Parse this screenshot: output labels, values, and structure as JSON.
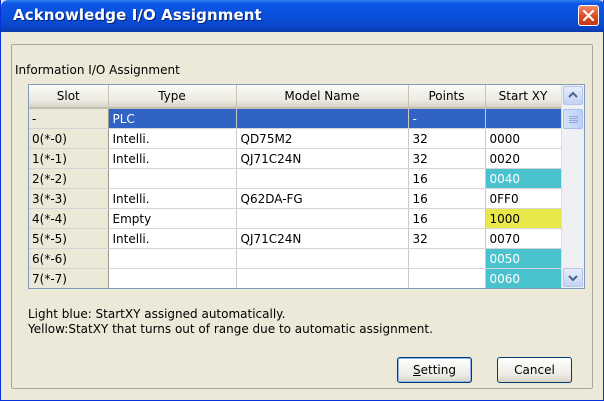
{
  "window": {
    "title": "Acknowledge I/O Assignment"
  },
  "group": {
    "label": "Information I/O Assignment"
  },
  "table": {
    "columns": [
      "Slot",
      "Type",
      "Model Name",
      "Points",
      "Start XY"
    ],
    "rows": [
      {
        "slot": "-",
        "type": "PLC",
        "model": "",
        "points": "-",
        "start": "",
        "highlight": "selected"
      },
      {
        "slot": "0(*-0)",
        "type": "Intelli.",
        "model": "QD75M2",
        "points": "32",
        "start": "0000",
        "highlight": ""
      },
      {
        "slot": "1(*-1)",
        "type": "Intelli.",
        "model": "QJ71C24N",
        "points": "32",
        "start": "0020",
        "highlight": ""
      },
      {
        "slot": "2(*-2)",
        "type": "",
        "model": "",
        "points": "16",
        "start": "0040",
        "highlight": "auto"
      },
      {
        "slot": "3(*-3)",
        "type": "Intelli.",
        "model": "Q62DA-FG",
        "points": "16",
        "start": "0FF0",
        "highlight": ""
      },
      {
        "slot": "4(*-4)",
        "type": "Empty",
        "model": "",
        "points": "16",
        "start": "1000",
        "highlight": "outrange"
      },
      {
        "slot": "5(*-5)",
        "type": "Intelli.",
        "model": "QJ71C24N",
        "points": "32",
        "start": "0070",
        "highlight": ""
      },
      {
        "slot": "6(*-6)",
        "type": "",
        "model": "",
        "points": "",
        "start": "0050",
        "highlight": "auto"
      },
      {
        "slot": "7(*-7)",
        "type": "",
        "model": "",
        "points": "",
        "start": "0060",
        "highlight": "auto"
      }
    ]
  },
  "notes": {
    "light_blue": "Light blue: StartXY assigned automatically.",
    "yellow": "Yellow:StatXY that turns out of range due to automatic assignment."
  },
  "buttons": {
    "setting": {
      "prefix": "",
      "mnemonic": "S",
      "rest": "etting"
    },
    "cancel": "Cancel"
  },
  "colors": {
    "auto_assigned": "#4bc3cf",
    "out_of_range": "#e8e84a",
    "selection": "#3163c5",
    "title_bar": "#0a4fd9"
  },
  "icons": {
    "close": "close-icon",
    "scroll_up": "chevron-up-icon",
    "scroll_down": "chevron-down-icon"
  }
}
